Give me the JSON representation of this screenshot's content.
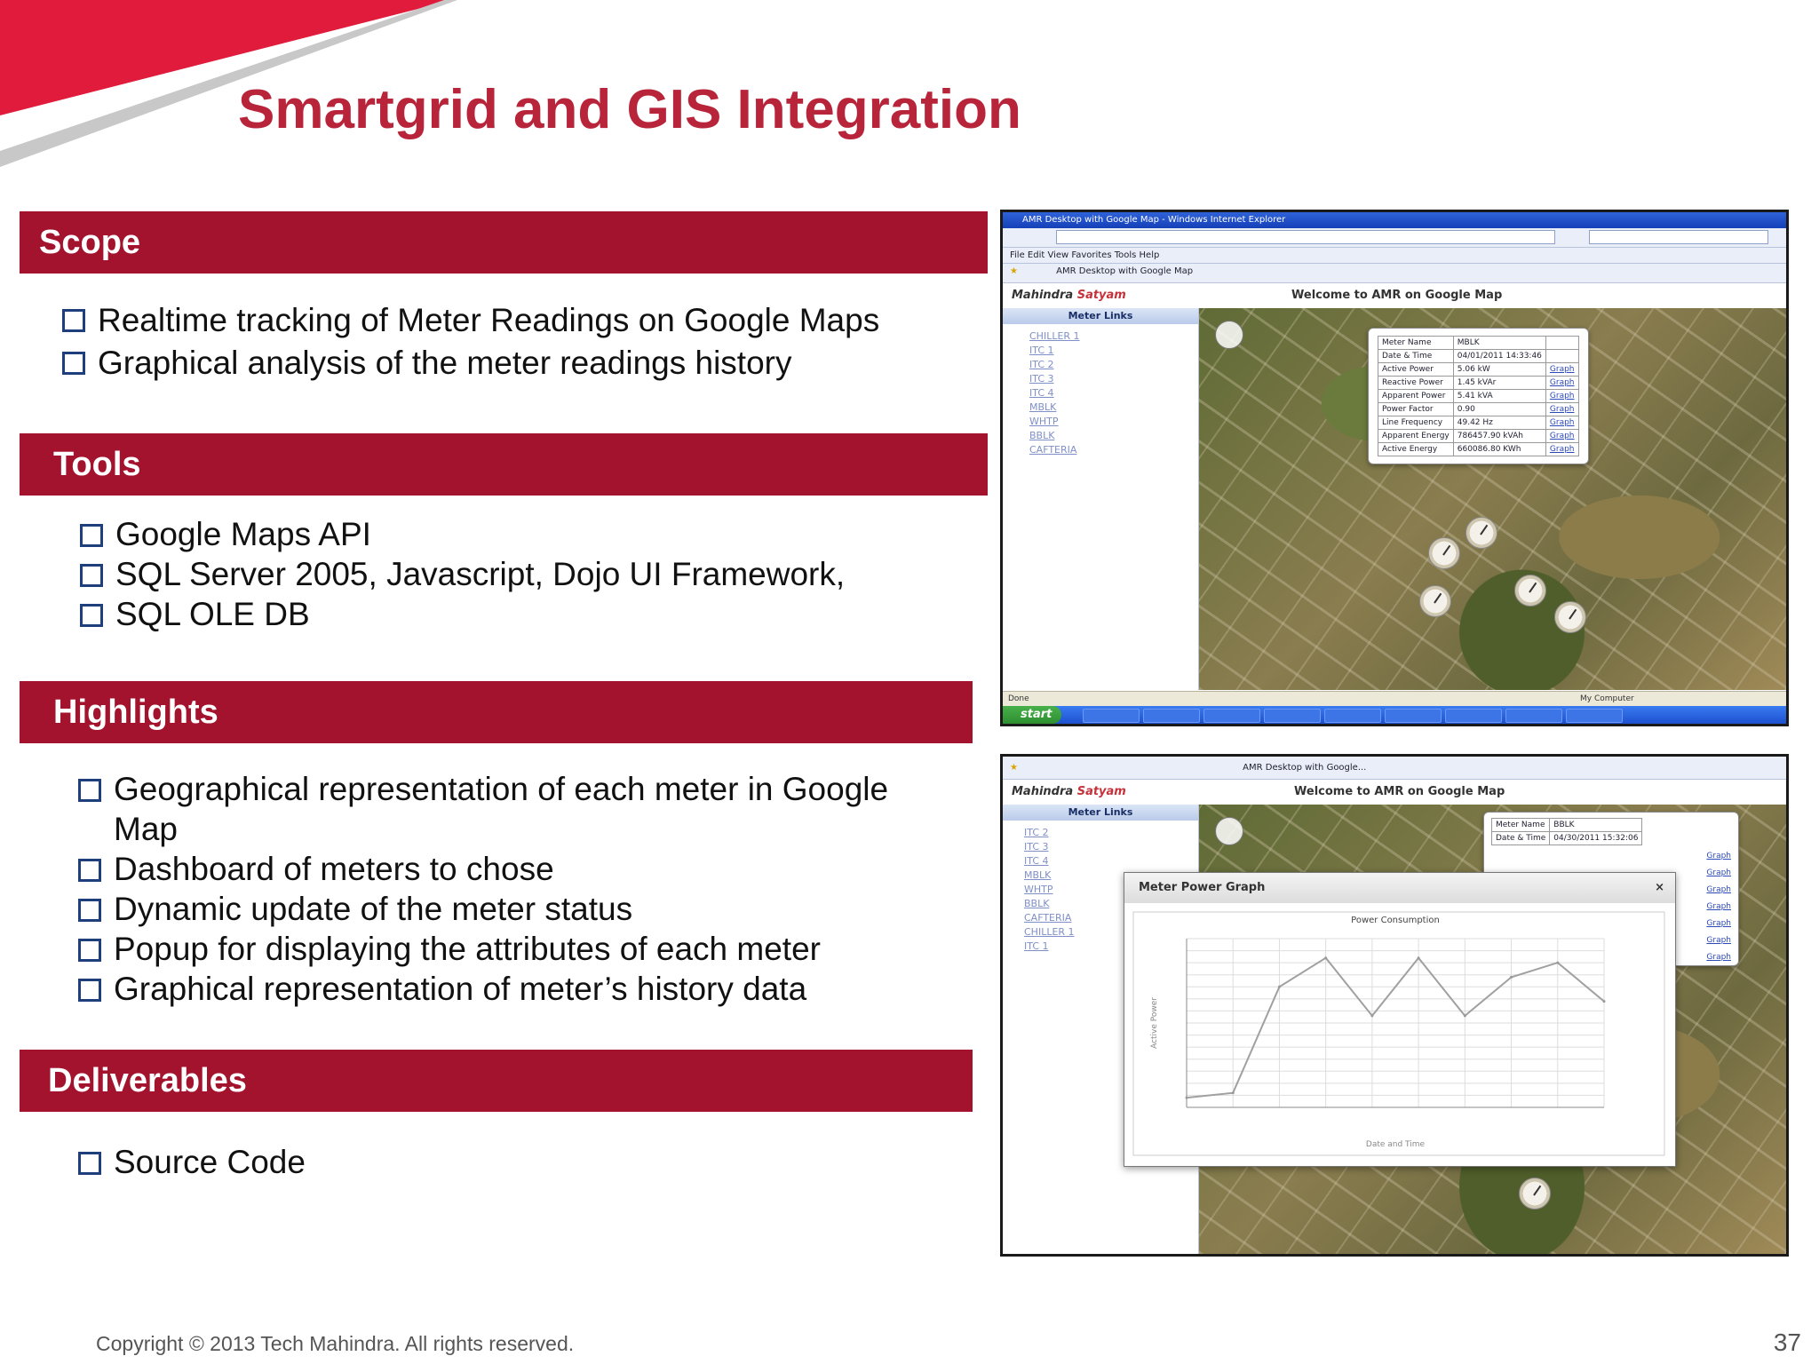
{
  "slide": {
    "title": "Smartgrid and GIS Integration",
    "footer": "Copyright © 2013 Tech Mahindra. All rights reserved.",
    "page_number": "37",
    "colors": {
      "title": "#b8243a",
      "band": "#a3132e",
      "bullet": "#1f3e7c"
    }
  },
  "sections": {
    "scope": {
      "heading": "Scope",
      "items": [
        "Realtime tracking of Meter Readings on Google Maps",
        "Graphical analysis of the meter readings history"
      ]
    },
    "tools": {
      "heading": "Tools",
      "items": [
        "Google Maps API",
        "SQL Server 2005, Javascript, Dojo UI Framework,",
        "SQL OLE DB"
      ]
    },
    "highlights": {
      "heading": "Highlights",
      "items": [
        "Geographical representation of each meter in Google Map",
        "Dashboard of meters to chose",
        "Dynamic update of the meter status",
        "Popup for displaying the attributes of each meter",
        "Graphical representation of meter’s history data"
      ]
    },
    "deliverables": {
      "heading": "Deliverables",
      "items": [
        "Source Code"
      ]
    }
  },
  "screenshot1": {
    "window_title": "AMR Desktop with Google Map - Windows Internet Explorer",
    "menu": "File  Edit  View  Favorites  Tools  Help",
    "favorites_tab": "AMR Desktop with Google Map",
    "brand_name": "Mahindra",
    "brand_accent": "Satyam",
    "welcome": "Welcome to AMR on Google Map",
    "side_header": "Meter Links",
    "meter_links": [
      "CHILLER 1",
      "ITC 1",
      "ITC 2",
      "ITC 3",
      "ITC 4",
      "MBLK",
      "WHTP",
      "BBLK",
      "CAFTERIA"
    ],
    "popup_rows": [
      {
        "label": "Meter Name",
        "value": "MBLK",
        "link": ""
      },
      {
        "label": "Date & Time",
        "value": "04/01/2011 14:33:46",
        "link": ""
      },
      {
        "label": "Active Power",
        "value": "5.06 kW",
        "link": "Graph"
      },
      {
        "label": "Reactive Power",
        "value": "1.45 kVAr",
        "link": "Graph"
      },
      {
        "label": "Apparent Power",
        "value": "5.41 kVA",
        "link": "Graph"
      },
      {
        "label": "Power Factor",
        "value": "0.90",
        "link": "Graph"
      },
      {
        "label": "Line Frequency",
        "value": "49.42 Hz",
        "link": "Graph"
      },
      {
        "label": "Apparent Energy",
        "value": "786457.90 kVAh",
        "link": "Graph"
      },
      {
        "label": "Active Energy",
        "value": "660086.80 KWh",
        "link": "Graph"
      }
    ],
    "start_label": "start",
    "status_left": "Done",
    "status_right": "My Computer"
  },
  "screenshot2": {
    "favorites_tab": "AMR Desktop with Google...",
    "brand_name": "Mahindra",
    "brand_accent": "Satyam",
    "welcome": "Welcome to AMR on Google Map",
    "side_header": "Meter Links",
    "meter_links": [
      "ITC 2",
      "ITC 3",
      "ITC 4",
      "MBLK",
      "WHTP",
      "BBLK",
      "CAFTERIA",
      "CHILLER 1",
      "ITC 1"
    ],
    "popup_rows": [
      {
        "label": "Meter Name",
        "value": "BBLK"
      },
      {
        "label": "Date & Time",
        "value": "04/30/2011 15:32:06"
      }
    ],
    "graph_link": "Graph",
    "graph_window_title": "Meter Power Graph",
    "graph_close": "×"
  },
  "chart_data": {
    "type": "line",
    "title": "Power Consumption",
    "xlabel": "Date and Time",
    "ylabel": "Active Power",
    "x": [
      1,
      2,
      3,
      4,
      5,
      6,
      7,
      8,
      9,
      10
    ],
    "series": [
      {
        "values": [
          2,
          3,
          25,
          31,
          19,
          31,
          19,
          27,
          30,
          22
        ]
      }
    ],
    "ylim": [
      0,
      35
    ],
    "grid": true
  }
}
